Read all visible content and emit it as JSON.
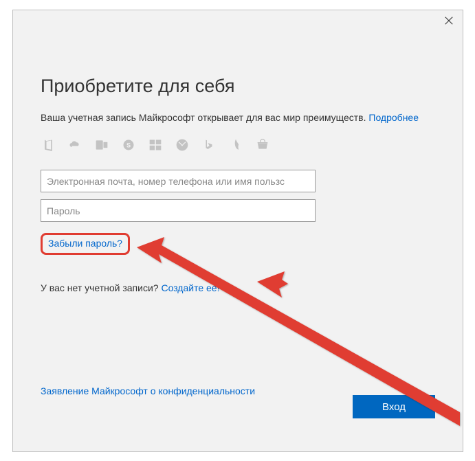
{
  "title": "Приобретите для себя",
  "subtitle": {
    "text": "Ваша учетная запись Майкрософт открывает для вас мир преимуществ. ",
    "more": "Подробнее"
  },
  "icons": [
    "office",
    "onedrive",
    "outlook",
    "skype",
    "windows",
    "xbox",
    "bing",
    "msn",
    "store"
  ],
  "fields": {
    "email_placeholder": "Электронная почта, номер телефона или имя пользс",
    "password_placeholder": "Пароль"
  },
  "forgot": "Забыли пароль?",
  "no_account": {
    "text": "У вас нет учетной записи? ",
    "create": "Создайте ее!"
  },
  "privacy": "Заявление Майкрософт о конфиденциальности",
  "signin": "Вход"
}
